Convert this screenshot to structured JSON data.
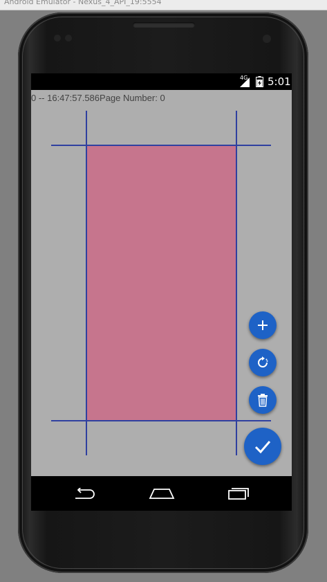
{
  "window": {
    "title": "Android Emulator - Nexus_4_API_19:5554"
  },
  "status_bar": {
    "network": "4G",
    "time": "5:01"
  },
  "app": {
    "info_text": "0 -- 16:47:57.586Page Number: 0"
  },
  "fabs": {
    "add": {
      "icon": "plus-icon"
    },
    "rotate": {
      "icon": "rotate-icon"
    },
    "delete": {
      "icon": "trash-icon"
    },
    "confirm": {
      "icon": "check-icon"
    }
  },
  "nav_bar": {
    "back": "back-icon",
    "home": "home-icon",
    "recents": "recents-icon"
  },
  "colors": {
    "page_fill": "#c6758d",
    "guide_lines": "#2f40a0",
    "fab": "#1e62c6",
    "app_background": "#aeaeae"
  }
}
